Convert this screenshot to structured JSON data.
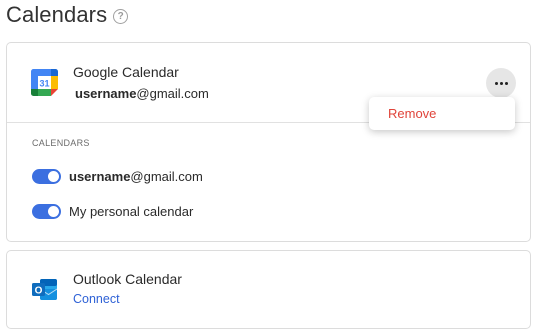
{
  "page": {
    "title": "Calendars",
    "help_glyph": "?",
    "help_icon": "question-circle-icon"
  },
  "google": {
    "name": "Google Calendar",
    "email_user": "username",
    "email_domain": "@gmail.com",
    "icon": "google-calendar-icon",
    "logo_text": "31",
    "more_icon": "more-horizontal-icon",
    "section_label": "CALENDARS",
    "calendars": [
      {
        "bold": "username",
        "rest": "@gmail.com",
        "enabled": true
      },
      {
        "bold": "",
        "rest": "My personal calendar",
        "enabled": true
      }
    ],
    "menu": {
      "remove_label": "Remove"
    }
  },
  "outlook": {
    "name": "Outlook Calendar",
    "action_label": "Connect",
    "icon": "outlook-icon",
    "logo_text": "O"
  },
  "colors": {
    "accent": "#3b6fe0",
    "link": "#2f62d6",
    "danger": "#e0443a"
  }
}
